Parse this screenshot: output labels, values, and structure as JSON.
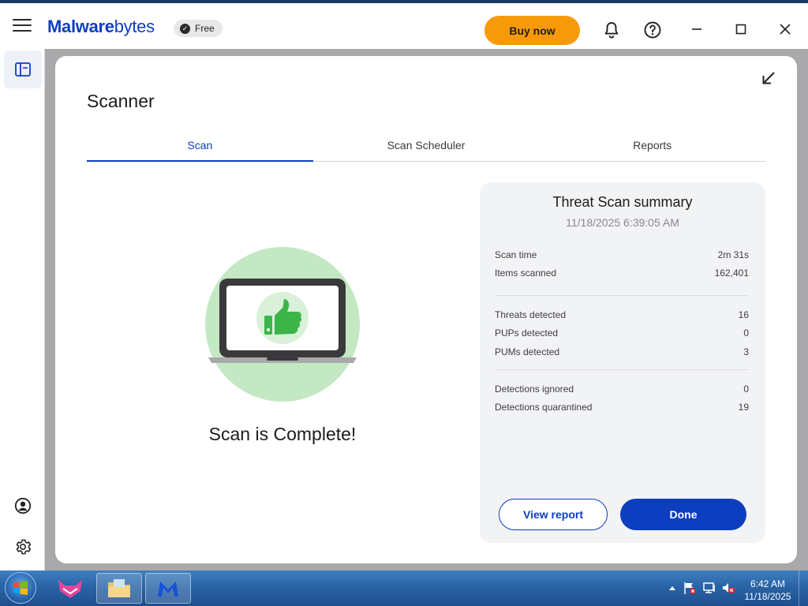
{
  "app": {
    "logo_bold": "Malware",
    "logo_light": "bytes",
    "plan_badge": "Free",
    "buy_label": "Buy now"
  },
  "icons": {
    "menu": "hamburger-menu-icon",
    "notifications": "bell-icon",
    "help": "question-icon",
    "minimize": "minimize-icon",
    "maximize": "maximize-icon",
    "close": "close-icon",
    "dashboard": "dashboard-icon",
    "account": "account-icon",
    "settings": "gear-icon",
    "collapse": "collapse-arrow-icon"
  },
  "scanner": {
    "title": "Scanner",
    "tabs": [
      {
        "label": "Scan",
        "active": true
      },
      {
        "label": "Scan Scheduler",
        "active": false
      },
      {
        "label": "Reports",
        "active": false
      }
    ],
    "status_text": "Scan is Complete!"
  },
  "summary": {
    "title": "Threat Scan summary",
    "date": "11/18/2025 6:39:05 AM",
    "groups": [
      [
        {
          "label": "Scan time",
          "value": "2m 31s"
        },
        {
          "label": "Items scanned",
          "value": "162,401"
        }
      ],
      [
        {
          "label": "Threats detected",
          "value": "16"
        },
        {
          "label": "PUPs detected",
          "value": "0"
        },
        {
          "label": "PUMs detected",
          "value": "3"
        }
      ],
      [
        {
          "label": "Detections ignored",
          "value": "0"
        },
        {
          "label": "Detections quarantined",
          "value": "19"
        }
      ]
    ],
    "view_report_label": "View report",
    "done_label": "Done"
  },
  "taskbar": {
    "time": "6:42 AM",
    "date": "11/18/2025"
  },
  "colors": {
    "brand_blue": "#0d3ec0",
    "buy_orange": "#f79a0a",
    "success_green": "#c3e8c3",
    "thumb_green": "#3bb54a"
  }
}
